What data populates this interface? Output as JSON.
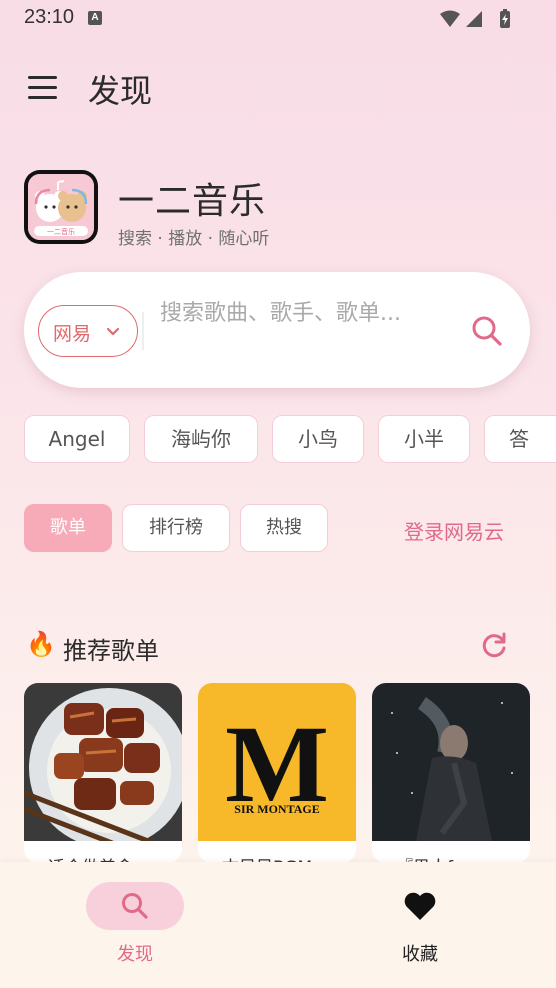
{
  "status_bar": {
    "time": "23:10",
    "notification_icon": "A"
  },
  "app_bar": {
    "title": "发现"
  },
  "brand": {
    "name": "一二音乐",
    "tagline": "搜索 · 播放 · 随心听",
    "logo_text": "一二音乐"
  },
  "search": {
    "source": "网易",
    "placeholder": "搜索歌曲、歌手、歌单..."
  },
  "quick_chips": [
    "Angel",
    "海屿你",
    "小鸟",
    "小半",
    "答"
  ],
  "tabs": [
    {
      "label": "歌单",
      "selected": true
    },
    {
      "label": "排行榜",
      "selected": false
    },
    {
      "label": "热搜",
      "selected": false
    }
  ],
  "login_link": "登录网易云",
  "section": {
    "icon": "🔥",
    "title": "推荐歌单"
  },
  "playlists": [
    {
      "title": "适合做美食",
      "cover": "braised-pork"
    },
    {
      "title": "古风风BGM",
      "cover": "sir-montage",
      "cover_text_main": "M",
      "cover_text_sub": "SIR MONTAGE"
    },
    {
      "title": "『男人forever』",
      "cover": "dark-portrait"
    }
  ],
  "bottom_nav": [
    {
      "label": "发现",
      "icon": "search-icon",
      "active": true
    },
    {
      "label": "收藏",
      "icon": "heart-icon",
      "active": false
    }
  ],
  "colors": {
    "accent": "#e06a8a",
    "chip_border": "#f2cfd6",
    "tab_selected": "#f7aab7"
  }
}
